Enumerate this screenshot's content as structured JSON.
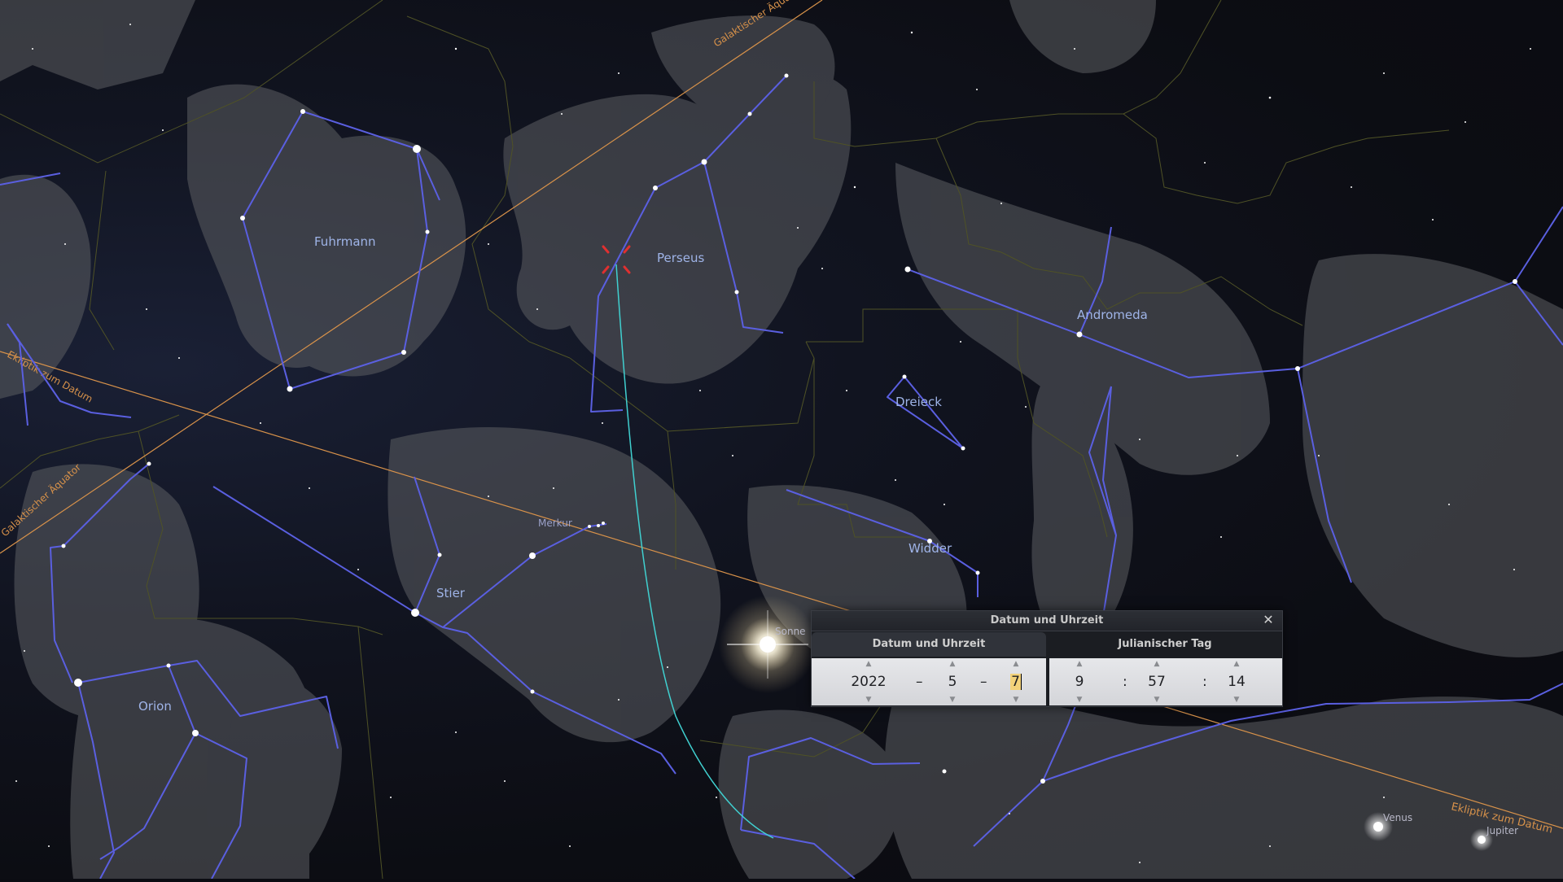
{
  "sky": {
    "constellations": [
      "Fuhrmann",
      "Perseus",
      "Andromeda",
      "Dreieck",
      "Merkur",
      "Stier",
      "Widder",
      "Orion"
    ],
    "planets": {
      "sun": "Sonne",
      "venus": "Venus",
      "jupiter": "Jupiter",
      "mercury": "Merkur"
    },
    "lines": {
      "galactic_equator": "Galaktischer Äquator",
      "ecliptic": "Ekliptik zum Datum"
    },
    "colors": {
      "constellation_line": "#5a5fe0",
      "label": "#9fb4e8",
      "galactic_line": "#e0a060",
      "ecliptic_line": "#e0a060",
      "boundary": "#5a5a2a",
      "trail": "#40d0d0",
      "target": "#e03030"
    }
  },
  "dialog": {
    "title": "Datum und Uhrzeit",
    "close_icon": "close-icon",
    "tab_date": "Datum und Uhrzeit",
    "tab_jd": "Julianischer Tag",
    "year": "2022",
    "month": "5",
    "day": "7",
    "hour": "9",
    "minute": "57",
    "second": "14",
    "date_sep": "–",
    "time_sep": ":",
    "arrow_up": "▲",
    "arrow_down": "▼"
  }
}
